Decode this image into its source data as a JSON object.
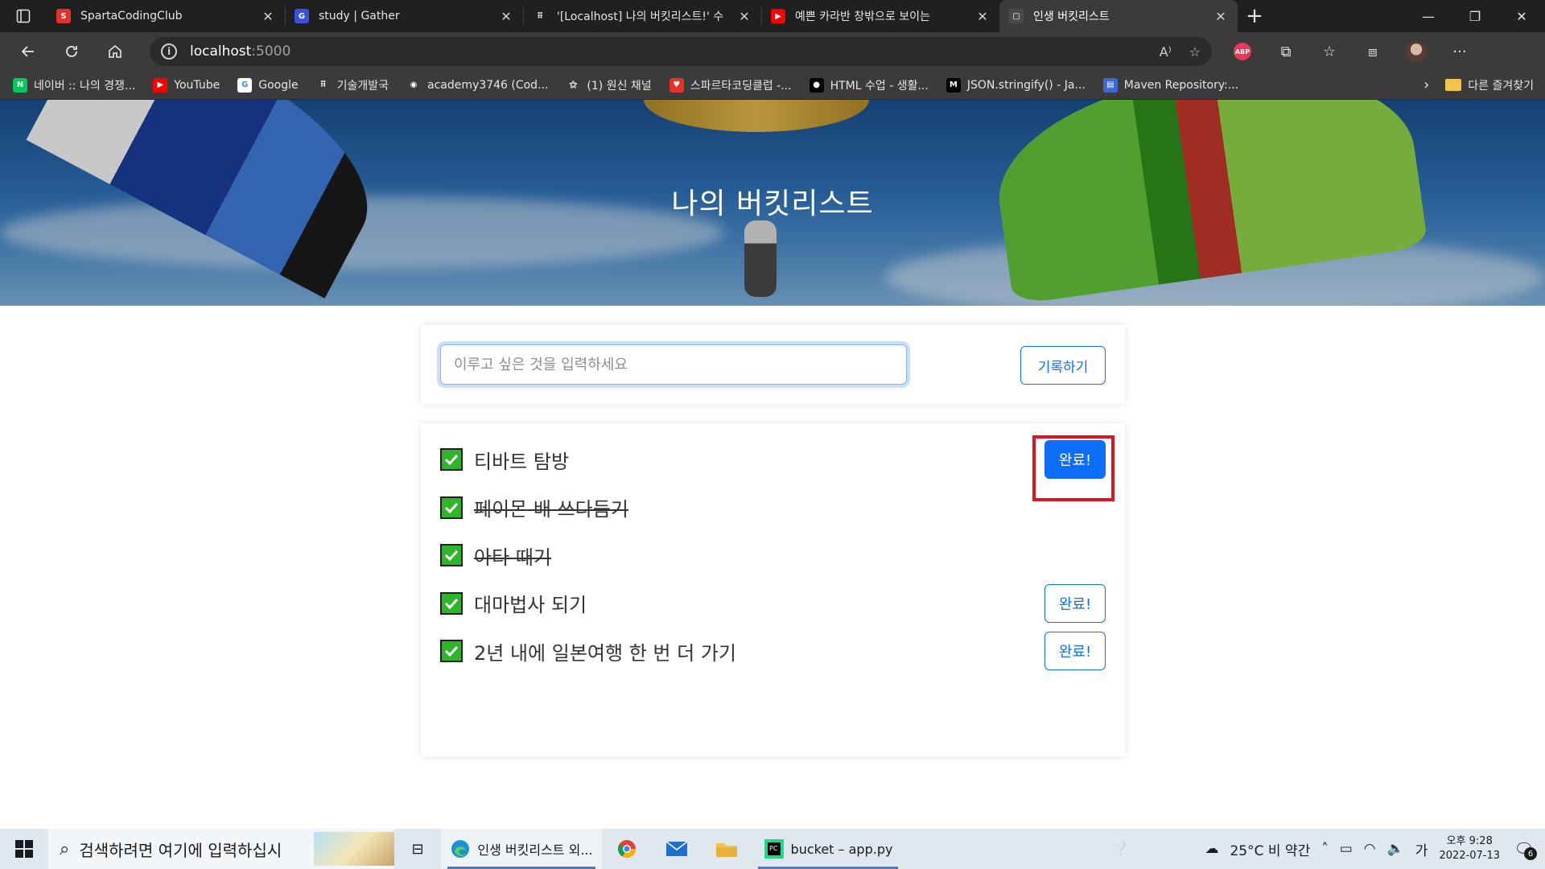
{
  "browser": {
    "tabs": [
      {
        "title": "SpartaCodingClub",
        "favicon_color": "#e4322b",
        "favicon_glyph": "S",
        "active": false
      },
      {
        "title": "study | Gather",
        "favicon_color": "#3a51e2",
        "favicon_glyph": "G",
        "active": false
      },
      {
        "title": "'[Localhost] 나의 버킷리스트!' 수",
        "favicon_color": "#202020",
        "favicon_glyph": "⠿",
        "active": false
      },
      {
        "title": "예쁜 카라반 창밖으로 보이는",
        "favicon_color": "#ff0000",
        "favicon_glyph": "▶",
        "active": false
      },
      {
        "title": "인생 버킷리스트",
        "favicon_color": "#4a4a4a",
        "favicon_glyph": "▢",
        "active": true
      }
    ],
    "new_tab_glyph": "+",
    "address": {
      "host": "localhost",
      "port": ":5000"
    },
    "bookmarks": [
      {
        "label": "네이버 :: 나의 경쟁...",
        "icon_color": "#03c75a",
        "glyph": "N"
      },
      {
        "label": "YouTube",
        "icon_color": "#ff0000",
        "glyph": "▶"
      },
      {
        "label": "Google",
        "icon_color": "#ffffff",
        "glyph": "G"
      },
      {
        "label": "기술개발국",
        "icon_color": "#3b3b3b",
        "glyph": "⠿"
      },
      {
        "label": "academy3746 (Cod...",
        "icon_color": "#3b3b3b",
        "glyph": "◉"
      },
      {
        "label": "(1) 원신 채널",
        "icon_color": "#3b3b3b",
        "glyph": "⚝"
      },
      {
        "label": "스파르타코딩클럽 -...",
        "icon_color": "#e4322b",
        "glyph": "♥"
      },
      {
        "label": "HTML 수업 - 생활...",
        "icon_color": "#000000",
        "glyph": "●"
      },
      {
        "label": "JSON.stringify() - Ja...",
        "icon_color": "#000000",
        "glyph": "M"
      },
      {
        "label": "Maven Repository:...",
        "icon_color": "#3b6bd1",
        "glyph": "▤"
      }
    ],
    "bookmark_more": "›",
    "other_bookmarks": "다른 즐겨찾기"
  },
  "page": {
    "title": "나의 버킷리스트",
    "input_placeholder": "이루고 싶은 것을 입력하세요",
    "save_label": "기록하기",
    "items": [
      {
        "text": "티바트 탐방",
        "done": false,
        "button_label": "완료!",
        "button_primary": true
      },
      {
        "text": "페이몬 배 쓰다듬기",
        "done": true
      },
      {
        "text": "아타 때기",
        "done": true
      },
      {
        "text": "대마법사 되기",
        "done": false,
        "button_label": "완료!",
        "button_primary": false
      },
      {
        "text": "2년 내에 일본여행 한 번 더 가기",
        "done": false,
        "button_label": "완료!",
        "button_primary": false
      }
    ]
  },
  "taskbar": {
    "search_placeholder": "검색하려면 여기에 입력하십시",
    "apps": [
      {
        "label": "인생 버킷리스트 외..."
      },
      {
        "label": "bucket – app.py"
      }
    ],
    "weather": "25°C  비 약간",
    "ime": "가",
    "time": "오후 9:28",
    "date": "2022-07-13",
    "notification_count": "6"
  },
  "colors": {
    "accent": "#0d6efd",
    "check_green": "#2fb52a",
    "highlight_red": "#e0141c"
  }
}
